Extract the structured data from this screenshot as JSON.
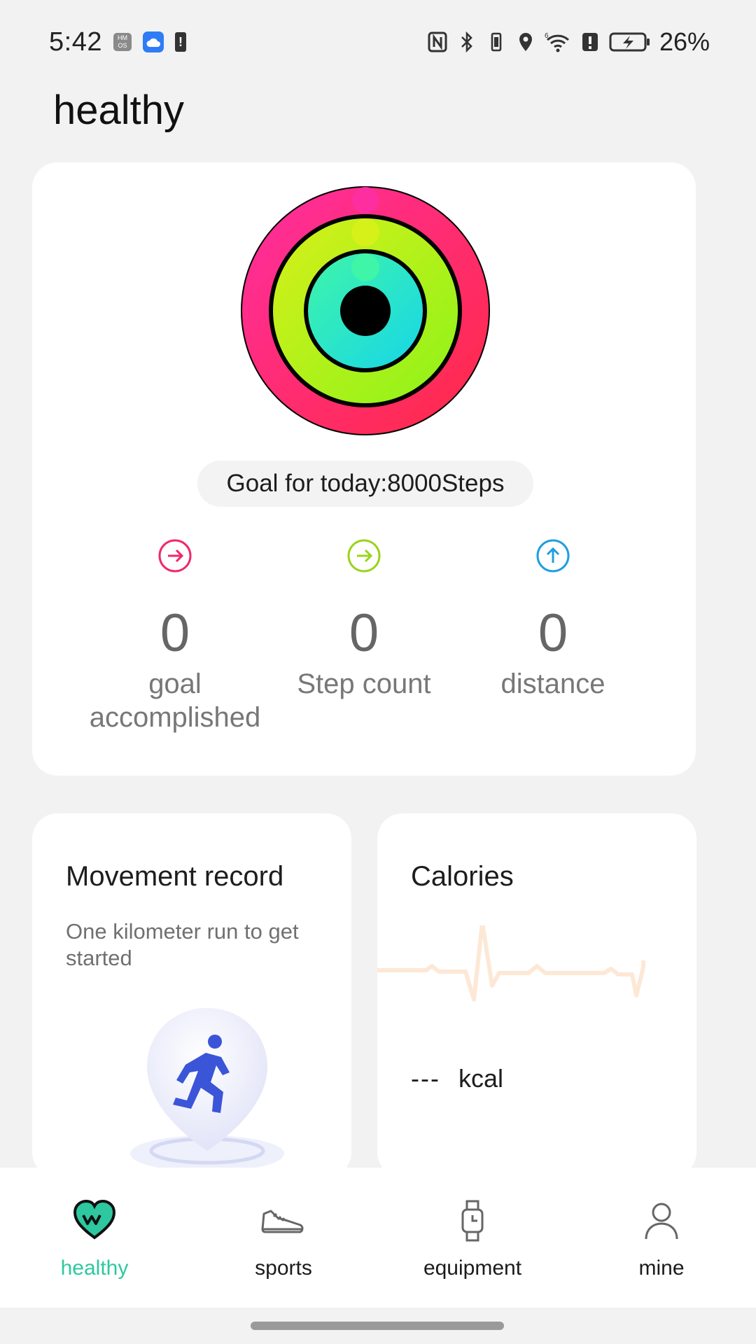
{
  "status_bar": {
    "time": "5:42",
    "hmos_text": "HM OS",
    "battery_percent": "26%",
    "icons": [
      "nfc-icon",
      "bluetooth-icon",
      "vibrate-icon",
      "location-icon",
      "wifi-6-icon",
      "alert-icon",
      "battery-charging-icon"
    ]
  },
  "page": {
    "title": "healthy"
  },
  "summary": {
    "goal_text": "Goal for today:8000Steps",
    "rings": {
      "outer_color": "#ff2d6a",
      "middle_color": "#b4ef1a",
      "inner_color": "#28e6c2"
    },
    "stats": [
      {
        "icon": "arrow-right-circle-icon",
        "color": "#f0286b",
        "value": "0",
        "label_lines": [
          "goal",
          "accomplished"
        ]
      },
      {
        "icon": "arrow-right-circle-icon",
        "color": "#9ad41c",
        "value": "0",
        "label_lines": [
          "Step count"
        ]
      },
      {
        "icon": "arrow-up-circle-icon",
        "color": "#1f9ee0",
        "value": "0",
        "label_lines": [
          "distance"
        ]
      }
    ]
  },
  "movement_card": {
    "title": "Movement record",
    "description": "One kilometer run to get started"
  },
  "calories_card": {
    "title": "Calories",
    "value": "---",
    "unit": "kcal"
  },
  "nav": {
    "accent_color": "#2ec8a0",
    "items": [
      {
        "label": "healthy",
        "icon": "heart-icon",
        "active": true
      },
      {
        "label": "sports",
        "icon": "sneaker-icon",
        "active": false
      },
      {
        "label": "equipment",
        "icon": "watch-icon",
        "active": false
      },
      {
        "label": "mine",
        "icon": "person-icon",
        "active": false
      }
    ]
  }
}
